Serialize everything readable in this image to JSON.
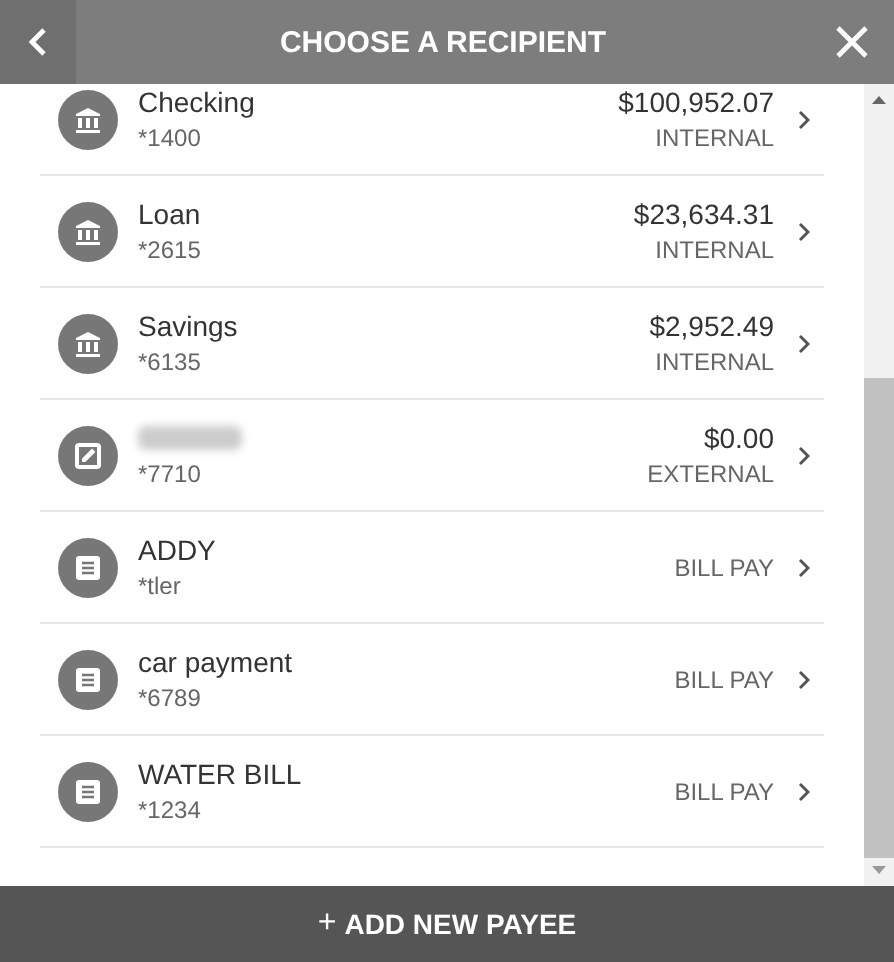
{
  "header": {
    "title": "CHOOSE A RECIPIENT"
  },
  "recipients": [
    {
      "kind": "bank",
      "name": "Checking",
      "account": "*1400",
      "amount": "$100,952.07",
      "type": "INTERNAL"
    },
    {
      "kind": "bank",
      "name": "Loan",
      "account": "*2615",
      "amount": "$23,634.31",
      "type": "INTERNAL"
    },
    {
      "kind": "bank",
      "name": "Savings",
      "account": "*6135",
      "amount": "$2,952.49",
      "type": "INTERNAL"
    },
    {
      "kind": "external",
      "account": "*7710",
      "amount": "$0.00",
      "type": "EXTERNAL"
    },
    {
      "kind": "bill",
      "name": "ADDY",
      "account": "*tler",
      "type": "BILL PAY"
    },
    {
      "kind": "bill",
      "name": "car payment",
      "account": "*6789",
      "type": "BILL PAY"
    },
    {
      "kind": "bill",
      "name": "WATER BILL",
      "account": "*1234",
      "type": "BILL PAY"
    }
  ],
  "footer": {
    "label": "ADD NEW PAYEE",
    "icon": "+"
  }
}
